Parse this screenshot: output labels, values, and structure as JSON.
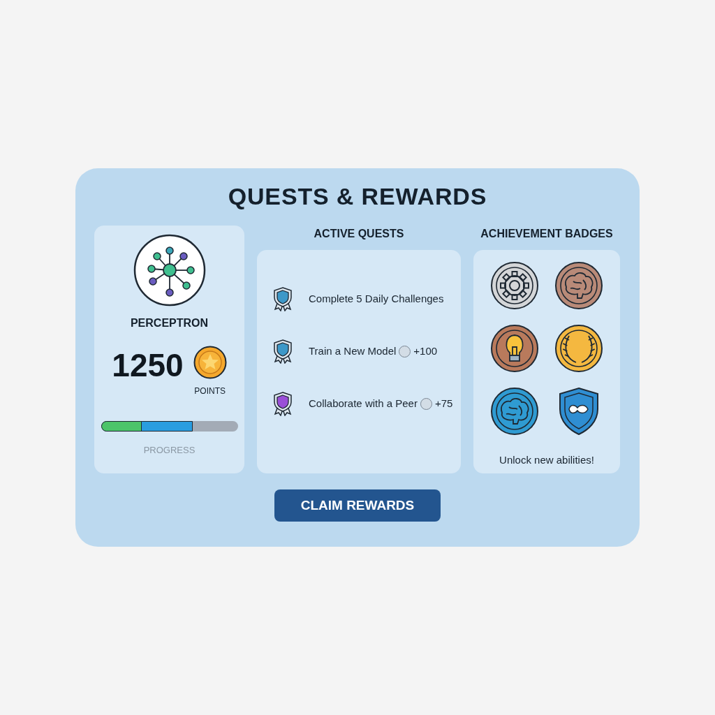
{
  "title": "QUESTS & REWARDS",
  "profile": {
    "name": "PERCEPTRON",
    "points": "1250",
    "points_label": "POINTS",
    "progress_label": "PROGRESS",
    "segments": [
      {
        "level": 0.3,
        "color": "#4cc46a"
      },
      {
        "level": 0.67,
        "color": "#2a9de0"
      }
    ]
  },
  "quests": {
    "heading": "ACTIVE QUESTS",
    "items": [
      {
        "label": "Complete 5 Daily Challenges",
        "color": "#3d98c8"
      },
      {
        "label": "Train a New Model",
        "checked": false,
        "reward": "+100",
        "color": "#3d98c8"
      },
      {
        "label": "Collaborate with a Peer",
        "checked": false,
        "reward": "+75",
        "color": "#9a4fd8"
      }
    ]
  },
  "badges": {
    "heading": "ACHIEVEMENT BADGES",
    "items": [
      {
        "kind": "gear",
        "color": "#d4d6d8"
      },
      {
        "kind": "brain",
        "color": "#b98a78"
      },
      {
        "kind": "bulb",
        "color": "#b97a5c"
      },
      {
        "kind": "laurel",
        "color": "#f4b840"
      },
      {
        "kind": "brain",
        "color": "#2f9bd2"
      },
      {
        "kind": "shield",
        "color": "#2f8ed2"
      }
    ],
    "caption": "Unlock new abilities!"
  },
  "button": "CLAIM REWARDS"
}
